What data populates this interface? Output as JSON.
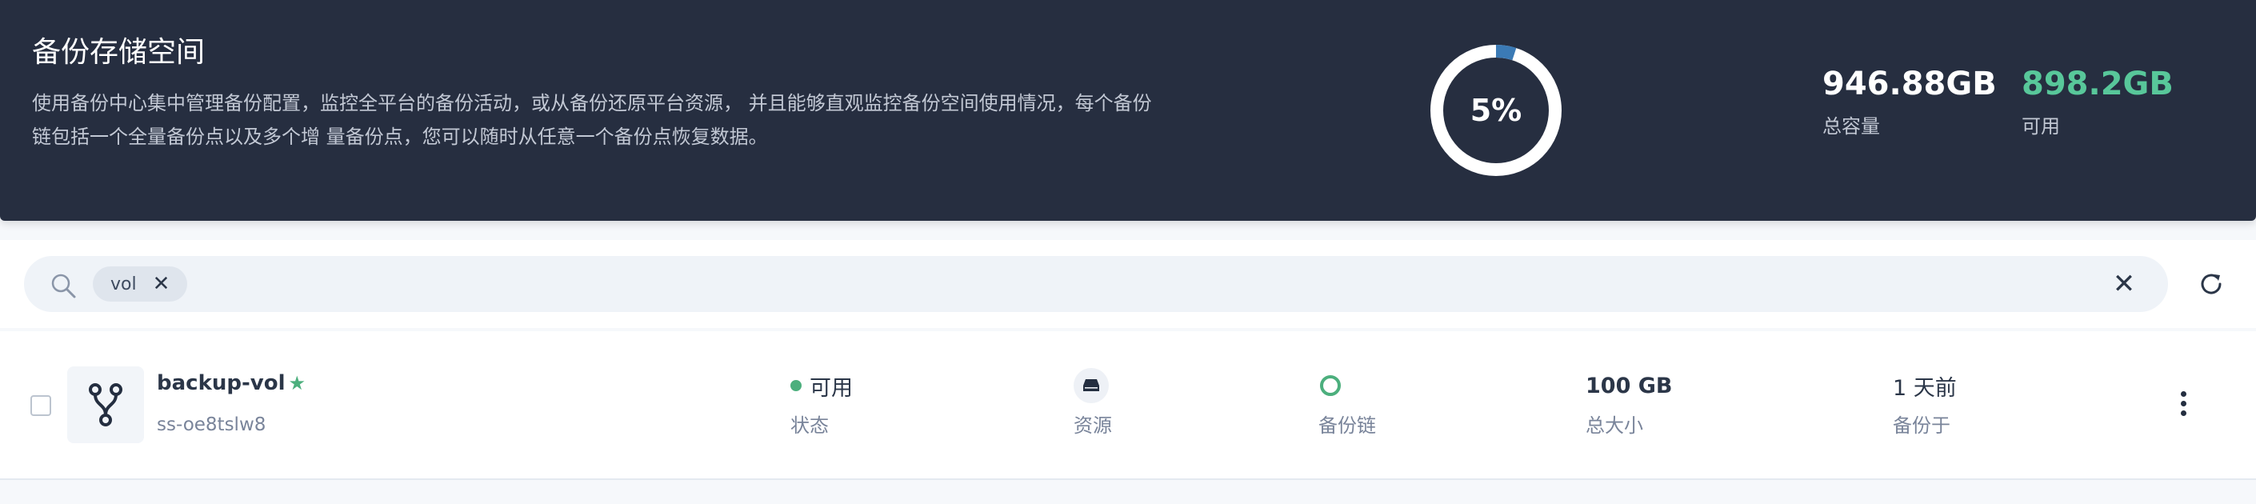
{
  "banner": {
    "title": "备份存储空间",
    "description": "使用备份中心集中管理备份配置，监控全平台的备份活动，或从备份还原平台资源， 并且能够直观监控备份空间使用情况，每个备份链包括一个全量备份点以及多个增 量备份点，您可以随时从任意一个备份点恢复数据。",
    "usage_percent_text": "5%",
    "usage_fraction": 0.05,
    "ring_color": "#3b7ab5",
    "total": {
      "value": "946.88GB",
      "label": "总容量"
    },
    "available": {
      "value": "898.2GB",
      "label": "可用",
      "color": "#58c79a"
    }
  },
  "search": {
    "icon": "search-icon",
    "tag_label": "vol",
    "tag_close": "✕",
    "clear_icon": "✕",
    "refresh_icon": "refresh-icon"
  },
  "row": {
    "name": "backup-vol",
    "star": "★",
    "id": "ss-oe8tslw8",
    "status": {
      "value": "可用",
      "label": "状态",
      "color": "#4caf7d"
    },
    "resource": {
      "label": "资源",
      "icon": "disk-icon"
    },
    "chain": {
      "label": "备份链",
      "icon": "chain-icon"
    },
    "size": {
      "value": "100 GB",
      "label": "总大小"
    },
    "backed_up": {
      "value": "1 天前",
      "label": "备份于"
    }
  }
}
